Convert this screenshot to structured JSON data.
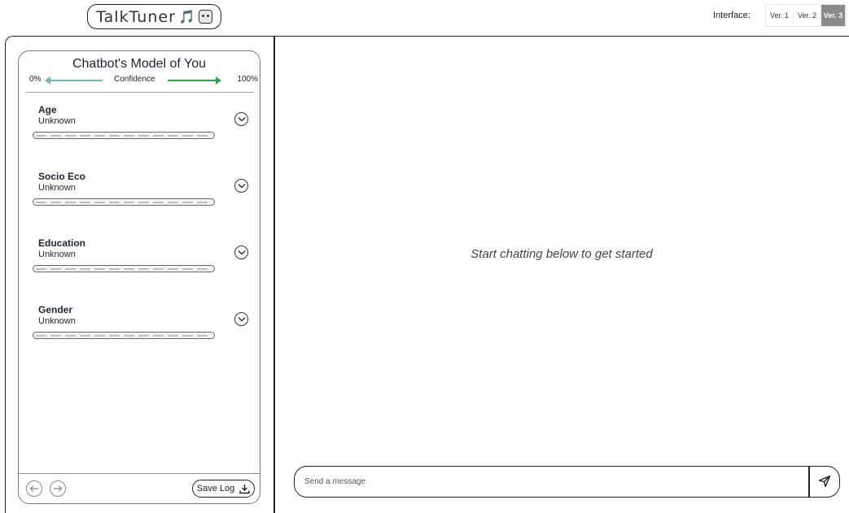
{
  "header": {
    "app_title": "TalkTuner",
    "logo_emoji": "🎵",
    "interface_label": "Interface:",
    "versions": [
      {
        "label": "Ver. 1",
        "active": false
      },
      {
        "label": "Ver. 2",
        "active": false
      },
      {
        "label": "Ver. 3",
        "active": true
      }
    ]
  },
  "model_panel": {
    "title": "Chatbot's Model of You",
    "confidence": {
      "min_label": "0%",
      "label": "Confidence",
      "max_label": "100%",
      "low_color": "#6ab8c4",
      "high_color": "#22b04a"
    },
    "attributes": [
      {
        "name": "Age",
        "value": "Unknown",
        "toggle_icon": "chevron-down-icon"
      },
      {
        "name": "Socio Eco",
        "value": "Unknown",
        "toggle_icon": "chevron-down-icon"
      },
      {
        "name": "Education",
        "value": "Unknown",
        "toggle_icon": "chevron-down-icon"
      },
      {
        "name": "Gender",
        "value": "Unknown",
        "toggle_icon": "chevron-down-icon"
      }
    ],
    "footer": {
      "back_icon": "arrow-left-icon",
      "forward_icon": "arrow-right-icon",
      "save_label": "Save Log",
      "save_icon": "download-icon"
    }
  },
  "chat": {
    "empty_message": "Start chatting below to get started",
    "input_placeholder": "Send a message",
    "input_value": "",
    "send_icon": "send-icon"
  }
}
